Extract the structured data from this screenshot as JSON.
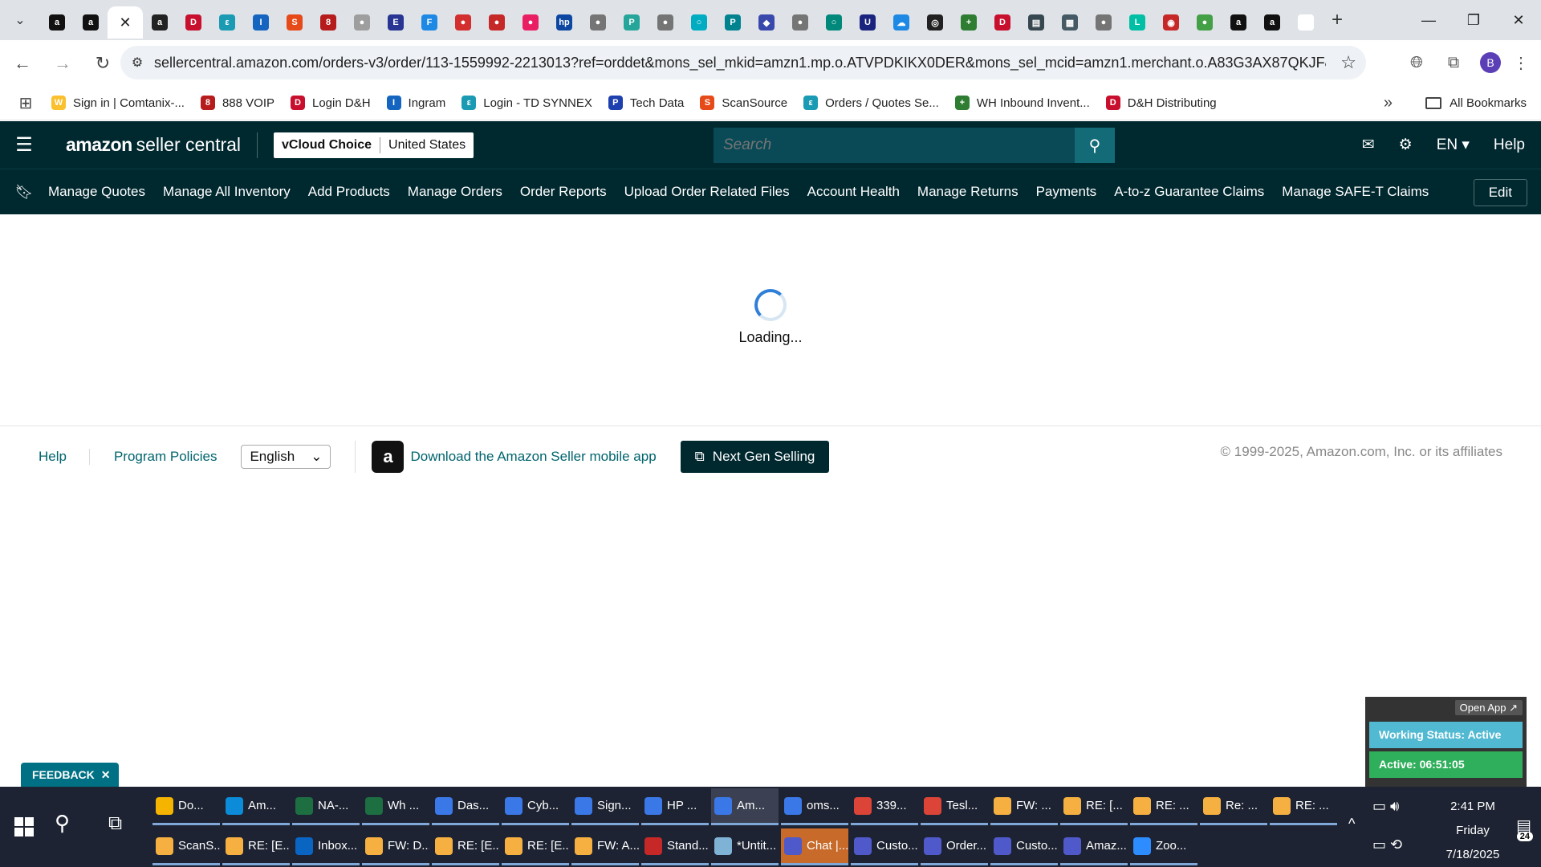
{
  "browser": {
    "tabs": [
      {
        "icon": "amazon-a-icon",
        "color": "#111111",
        "glyph": "a"
      },
      {
        "icon": "amazon-a-icon",
        "color": "#111111",
        "glyph": "a"
      },
      {
        "icon": "close-icon",
        "color": "#ffffff",
        "glyph": "✕",
        "active": true
      },
      {
        "icon": "amazon-circle-icon",
        "color": "#222222",
        "glyph": "a"
      },
      {
        "icon": "dh-icon",
        "color": "#c8102e",
        "glyph": "D"
      },
      {
        "icon": "ec-icon",
        "color": "#1a9bb3",
        "glyph": "ε"
      },
      {
        "icon": "ingram-icon",
        "color": "#1565c0",
        "glyph": "I"
      },
      {
        "icon": "scansource-icon",
        "color": "#e64a19",
        "glyph": "S"
      },
      {
        "icon": "voip-icon",
        "color": "#b71c1c",
        "glyph": "8"
      },
      {
        "icon": "globe-icon",
        "color": "#9e9e9e",
        "glyph": "●"
      },
      {
        "icon": "etn-icon",
        "color": "#283593",
        "glyph": "E"
      },
      {
        "icon": "f-icon",
        "color": "#1e88e5",
        "glyph": "F"
      },
      {
        "icon": "red-circle-icon",
        "color": "#d32f2f",
        "glyph": "●"
      },
      {
        "icon": "red-circle-icon",
        "color": "#c62828",
        "glyph": "●"
      },
      {
        "icon": "pink-circle-icon",
        "color": "#e91e63",
        "glyph": "●"
      },
      {
        "icon": "hp-icon",
        "color": "#0d47a1",
        "glyph": "hp"
      },
      {
        "icon": "globe-icon",
        "color": "#757575",
        "glyph": "●"
      },
      {
        "icon": "p-icon",
        "color": "#26a69a",
        "glyph": "P"
      },
      {
        "icon": "globe-icon",
        "color": "#757575",
        "glyph": "●"
      },
      {
        "icon": "ring-icon",
        "color": "#00acc1",
        "glyph": "○"
      },
      {
        "icon": "teal-p-icon",
        "color": "#00838f",
        "glyph": "P"
      },
      {
        "icon": "shield-icon",
        "color": "#3949ab",
        "glyph": "◆"
      },
      {
        "icon": "globe-icon",
        "color": "#757575",
        "glyph": "●"
      },
      {
        "icon": "tealring-icon",
        "color": "#00897b",
        "glyph": "○"
      },
      {
        "icon": "u-icon",
        "color": "#1a237e",
        "glyph": "U"
      },
      {
        "icon": "cloud-icon",
        "color": "#1e88e5",
        "glyph": "☁"
      },
      {
        "icon": "target-icon",
        "color": "#212121",
        "glyph": "◎"
      },
      {
        "icon": "plus-green-icon",
        "color": "#2e7d32",
        "glyph": "+"
      },
      {
        "icon": "dh-icon",
        "color": "#c8102e",
        "glyph": "D"
      },
      {
        "icon": "doc-icon",
        "color": "#37474f",
        "glyph": "▤"
      },
      {
        "icon": "bar-icon",
        "color": "#455a64",
        "glyph": "▦"
      },
      {
        "icon": "globe-icon",
        "color": "#757575",
        "glyph": "●"
      },
      {
        "icon": "logi-icon",
        "color": "#00bfa5",
        "glyph": "L"
      },
      {
        "icon": "car-icon",
        "color": "#c62828",
        "glyph": "◉"
      },
      {
        "icon": "green-circle-icon",
        "color": "#43a047",
        "glyph": "●"
      },
      {
        "icon": "amazon-a-icon",
        "color": "#111111",
        "glyph": "a"
      },
      {
        "icon": "amazon-a-icon",
        "color": "#111111",
        "glyph": "a"
      },
      {
        "icon": "google-icon",
        "color": "#ffffff",
        "glyph": "G"
      }
    ],
    "url": "sellercentral.amazon.com/orders-v3/order/113-1559992-2213013?ref=orddet&mons_sel_mkid=amzn1.mp.o.ATVPDKIKX0DER&mons_sel_mcid=amzn1.merchant.o.A83G3AX87QKJF&mon...",
    "profile_initial": "B",
    "bookmarks": [
      {
        "label": "Sign in | Comtanix-...",
        "icon": "w-icon",
        "color": "#fbc02d",
        "glyph": "W"
      },
      {
        "label": "888 VOIP",
        "icon": "voip-icon",
        "color": "#b71c1c",
        "glyph": "8"
      },
      {
        "label": "Login D&H",
        "icon": "dh-icon",
        "color": "#c8102e",
        "glyph": "D"
      },
      {
        "label": "Ingram",
        "icon": "ingram-icon",
        "color": "#1565c0",
        "glyph": "I"
      },
      {
        "label": "Login - TD SYNNEX",
        "icon": "ec-icon",
        "color": "#1a9bb3",
        "glyph": "ε"
      },
      {
        "label": "Tech Data",
        "icon": "p-icon",
        "color": "#1e40af",
        "glyph": "P"
      },
      {
        "label": "ScanSource",
        "icon": "scansource-icon",
        "color": "#e64a19",
        "glyph": "S"
      },
      {
        "label": "Orders / Quotes Se...",
        "icon": "ec-icon",
        "color": "#1a9bb3",
        "glyph": "ε"
      },
      {
        "label": "WH Inbound Invent...",
        "icon": "plus-green-icon",
        "color": "#2e7d32",
        "glyph": "+"
      },
      {
        "label": "D&H Distributing",
        "icon": "dh-icon",
        "color": "#c8102e",
        "glyph": "D"
      }
    ],
    "all_bookmarks": "All Bookmarks"
  },
  "header": {
    "logo_main": "amazon",
    "logo_sub": "seller central",
    "store_name": "vCloud Choice",
    "marketplace": "United States",
    "search_placeholder": "Search",
    "language": "EN",
    "help": "Help"
  },
  "nav": {
    "links": [
      "Manage Quotes",
      "Manage All Inventory",
      "Add Products",
      "Manage Orders",
      "Order Reports",
      "Upload Order Related Files",
      "Account Health",
      "Manage Returns",
      "Payments",
      "A-to-z Guarantee Claims",
      "Manage SAFE-T Claims"
    ],
    "edit": "Edit"
  },
  "main": {
    "loading_text": "Loading..."
  },
  "footer": {
    "help": "Help",
    "program_policies": "Program Policies",
    "language": "English",
    "app_download": "Download the Amazon Seller mobile app",
    "next_gen": "Next Gen Selling",
    "copyright": "© 1999-2025, Amazon.com, Inc. or its affiliates"
  },
  "widgets": {
    "feedback": "FEEDBACK",
    "open_app": "Open App ↗",
    "working_status": "Working Status: Active",
    "active_timer": "Active: 06:51:05"
  },
  "taskbar": {
    "row1": [
      {
        "label": "Do...",
        "icon": "file-explorer-icon",
        "color": "#f4b400"
      },
      {
        "label": "Am...",
        "icon": "edge-icon",
        "color": "#0b8bd8"
      },
      {
        "label": "NA-...",
        "icon": "excel-icon",
        "color": "#1d6f42"
      },
      {
        "label": "Wh ...",
        "icon": "excel-icon",
        "color": "#1d6f42"
      },
      {
        "label": "Das...",
        "icon": "chrome-icon",
        "color": "#3b78e7"
      },
      {
        "label": "Cyb...",
        "icon": "chrome-icon",
        "color": "#3b78e7"
      },
      {
        "label": "Sign...",
        "icon": "chrome-icon",
        "color": "#3b78e7"
      },
      {
        "label": "HP ...",
        "icon": "chrome-icon",
        "color": "#3b78e7"
      },
      {
        "label": "Am...",
        "icon": "chrome-icon",
        "color": "#3b78e7",
        "highlight": true
      },
      {
        "label": "oms...",
        "icon": "chrome-icon",
        "color": "#3b78e7"
      },
      {
        "label": "339...",
        "icon": "chrome-icon",
        "color": "#db4437"
      },
      {
        "label": "Tesl...",
        "icon": "chrome-icon",
        "color": "#db4437"
      },
      {
        "label": "FW: ...",
        "icon": "mail-icon",
        "color": "#f5b041"
      },
      {
        "label": "RE: [...",
        "icon": "mail-icon",
        "color": "#f5b041"
      },
      {
        "label": "RE: ...",
        "icon": "mail-icon",
        "color": "#f5b041"
      },
      {
        "label": "Re: ...",
        "icon": "mail-icon",
        "color": "#f5b041"
      },
      {
        "label": "RE: ...",
        "icon": "mail-icon",
        "color": "#f5b041"
      }
    ],
    "row2": [
      {
        "label": "ScanS...",
        "icon": "mail-icon",
        "color": "#f5b041"
      },
      {
        "label": "RE: [E...",
        "icon": "mail-icon",
        "color": "#f5b041"
      },
      {
        "label": "Inbox...",
        "icon": "outlook-icon",
        "color": "#0a64c2"
      },
      {
        "label": "FW: D...",
        "icon": "mail-icon",
        "color": "#f5b041"
      },
      {
        "label": "RE: [E...",
        "icon": "mail-icon",
        "color": "#f5b041"
      },
      {
        "label": "RE: [E...",
        "icon": "mail-icon",
        "color": "#f5b041"
      },
      {
        "label": "FW: A...",
        "icon": "mail-icon",
        "color": "#f5b041"
      },
      {
        "label": "Stand...",
        "icon": "pdf-icon",
        "color": "#c62828"
      },
      {
        "label": "*Untit...",
        "icon": "notepad-icon",
        "color": "#7fb3d5"
      },
      {
        "label": "Chat |...",
        "icon": "teams-icon",
        "color": "#5059c9",
        "orange": true
      },
      {
        "label": "Custo...",
        "icon": "teams-icon",
        "color": "#5059c9"
      },
      {
        "label": "Order...",
        "icon": "teams-icon",
        "color": "#5059c9"
      },
      {
        "label": "Custo...",
        "icon": "teams-icon",
        "color": "#5059c9"
      },
      {
        "label": "Amaz...",
        "icon": "teams-icon",
        "color": "#5059c9"
      },
      {
        "label": "Zoo...",
        "icon": "zoom-icon",
        "color": "#2d8cff"
      }
    ],
    "time": "2:41 PM",
    "day": "Friday",
    "date": "7/18/2025",
    "notifications": "24"
  }
}
